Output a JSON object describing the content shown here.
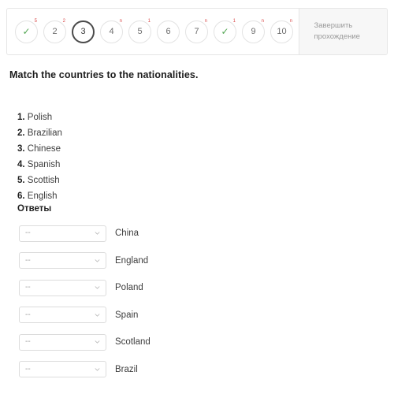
{
  "nav": {
    "steps": [
      {
        "label": "✓",
        "is_check": true,
        "badge": "5",
        "state": "done"
      },
      {
        "label": "2",
        "is_check": false,
        "badge": "2",
        "state": "default"
      },
      {
        "label": "3",
        "is_check": false,
        "badge": "",
        "state": "active"
      },
      {
        "label": "4",
        "is_check": false,
        "badge": "n",
        "state": "default"
      },
      {
        "label": "5",
        "is_check": false,
        "badge": "1",
        "state": "default"
      },
      {
        "label": "6",
        "is_check": false,
        "badge": "",
        "state": "default"
      },
      {
        "label": "7",
        "is_check": false,
        "badge": "n",
        "state": "default"
      },
      {
        "label": "✓",
        "is_check": true,
        "badge": "1",
        "state": "done"
      },
      {
        "label": "9",
        "is_check": false,
        "badge": "n",
        "state": "default"
      },
      {
        "label": "10",
        "is_check": false,
        "badge": "n",
        "state": "default"
      }
    ],
    "finish_button": "Завершить прохождение"
  },
  "question": {
    "title": "Match the countries to the nationalities.",
    "nationalities": [
      {
        "num": "1.",
        "text": "Polish"
      },
      {
        "num": "2.",
        "text": "Brazilian"
      },
      {
        "num": "3.",
        "text": "Chinese"
      },
      {
        "num": "4.",
        "text": "Spanish"
      },
      {
        "num": "5.",
        "text": "Scottish"
      },
      {
        "num": "6.",
        "text": "English"
      }
    ],
    "answers_heading": "Ответы",
    "answer_rows": [
      {
        "selected": "--",
        "country": "China"
      },
      {
        "selected": "--",
        "country": "England"
      },
      {
        "selected": "--",
        "country": "Poland"
      },
      {
        "selected": "--",
        "country": "Spain"
      },
      {
        "selected": "--",
        "country": "Scotland"
      },
      {
        "selected": "--",
        "country": "Brazil"
      }
    ]
  },
  "colors": {
    "check_green": "#53a653",
    "badge_red": "#d94a4a",
    "active_ring": "#4a4a4a",
    "panel_gray": "#f7f7f7"
  }
}
